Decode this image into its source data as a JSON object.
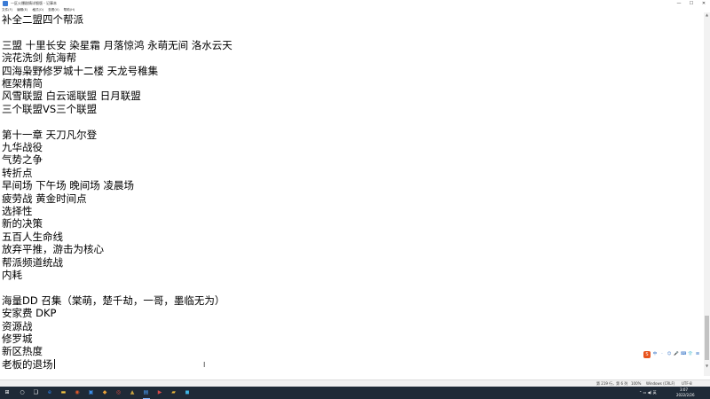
{
  "window": {
    "title": "一区火爆剧情详细版 - 记事本",
    "controls": [
      "—",
      "☐",
      "✕"
    ]
  },
  "menu": [
    "文件(F)",
    "编辑(E)",
    "格式(O)",
    "查看(V)",
    "帮助(H)"
  ],
  "editor": {
    "lines": [
      "补全二盟四个帮派",
      "",
      "三盟 十里长安 染星霜 月落惊鸿 永萌无间 洛水云天",
      "浣花洗剑 航海帮",
      "四海枭野修罗城十二楼 天龙号稚集",
      "框架精简",
      "风雪联盟 白云谣联盟 日月联盟",
      "三个联盟VS三个联盟",
      "",
      "第十一章 天刀凡尔登",
      "九华战役",
      "气势之争",
      "转折点",
      "早间场 下午场 晚间场 凌晨场",
      "疲劳战 黄金时间点",
      "选择性",
      "新的决策",
      "五百人生命线",
      "放弃平推，游击为核心",
      "帮派频道统战",
      "内耗",
      "",
      "海量DD 召集（棠萌，楚千劫，一哥，墨临无为）",
      "安家费 DKP",
      "资源战",
      "修罗城",
      "新区热度",
      "老板的退场"
    ]
  },
  "status": {
    "position": "第 219 行，第 6 列",
    "zoom": "100%",
    "line_ending": "Windows (CRLF)",
    "encoding": "UTF-8"
  },
  "ime": {
    "logo": "S",
    "items": [
      "中",
      "·",
      "☺",
      "🎤",
      "⌨",
      "👕",
      "⊞"
    ]
  },
  "taskbar": {
    "start_icon": "⊞",
    "apps": [
      {
        "icon": "search-icon",
        "glyph": "○",
        "color": "#ffffff"
      },
      {
        "icon": "task-view-icon",
        "glyph": "❑",
        "color": "#ffffff"
      },
      {
        "icon": "edge-icon",
        "glyph": "e",
        "color": "#2d8cff"
      },
      {
        "icon": "file-explorer-icon",
        "glyph": "▬",
        "color": "#f4c542"
      },
      {
        "icon": "browser-icon",
        "glyph": "◉",
        "color": "#e0592a"
      },
      {
        "icon": "store-icon",
        "glyph": "▣",
        "color": "#3d8eea"
      },
      {
        "icon": "app-icon",
        "glyph": "◆",
        "color": "#e8a13a"
      },
      {
        "icon": "chrome-icon",
        "glyph": "◎",
        "color": "#e54b3c"
      },
      {
        "icon": "game-icon",
        "glyph": "▲",
        "color": "#c9a441"
      },
      {
        "icon": "notepad-icon",
        "glyph": "▤",
        "color": "#4da3ff"
      },
      {
        "icon": "media-icon",
        "glyph": "▶",
        "color": "#d84a4a"
      },
      {
        "icon": "folder-icon",
        "glyph": "▰",
        "color": "#e8b63a"
      },
      {
        "icon": "video-icon",
        "glyph": "◼",
        "color": "#3fb5e5"
      }
    ],
    "tray": {
      "time": "3:07",
      "date": "2022/2/26",
      "indicators": "⌃ ▭ ◀) 英"
    }
  }
}
